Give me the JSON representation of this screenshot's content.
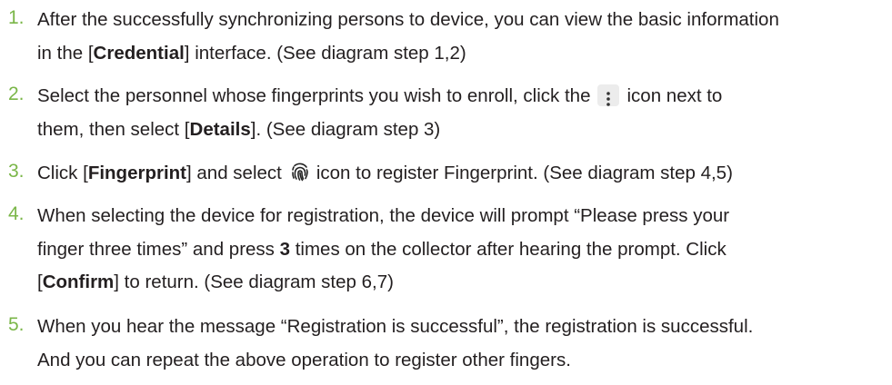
{
  "steps": [
    {
      "num": "1.",
      "line1": "After the successfully synchronizing persons to device, you can view the basic information",
      "line2_pre": "in the [",
      "line2_bold": "Credential",
      "line2_post": "] interface. (See diagram step 1,2)"
    },
    {
      "num": "2.",
      "line1_pre": "Select the personnel whose fingerprints you wish to enroll, click the",
      "line1_post": "icon next to",
      "line2_pre": "them, then select [",
      "line2_bold": "Details",
      "line2_post": "]. (See diagram step 3)",
      "icon": "more-vertical-icon"
    },
    {
      "num": "3.",
      "line1_pre": "Click [",
      "line1_bold": "Fingerprint",
      "line1_mid": "] and select",
      "line1_post": "icon to register Fingerprint. (See diagram step 4,5)",
      "icon": "fingerprint-icon"
    },
    {
      "num": "4.",
      "line1": "When selecting the device for registration, the device will prompt “Please press your",
      "line2_pre": "finger three times” and press ",
      "line2_bold": "3",
      "line2_post": " times on the collector after hearing the prompt. Click",
      "line3_pre": "[",
      "line3_bold": "Confirm",
      "line3_post": "] to return. (See diagram step 6,7)"
    },
    {
      "num": "5.",
      "line1": "When you hear the message “Registration is successful”, the registration is successful.",
      "line2": "And you can repeat the above operation to register other fingers."
    }
  ],
  "colors": {
    "number": "#7ab648",
    "text": "#231f20",
    "icon_bg": "#ececec"
  }
}
